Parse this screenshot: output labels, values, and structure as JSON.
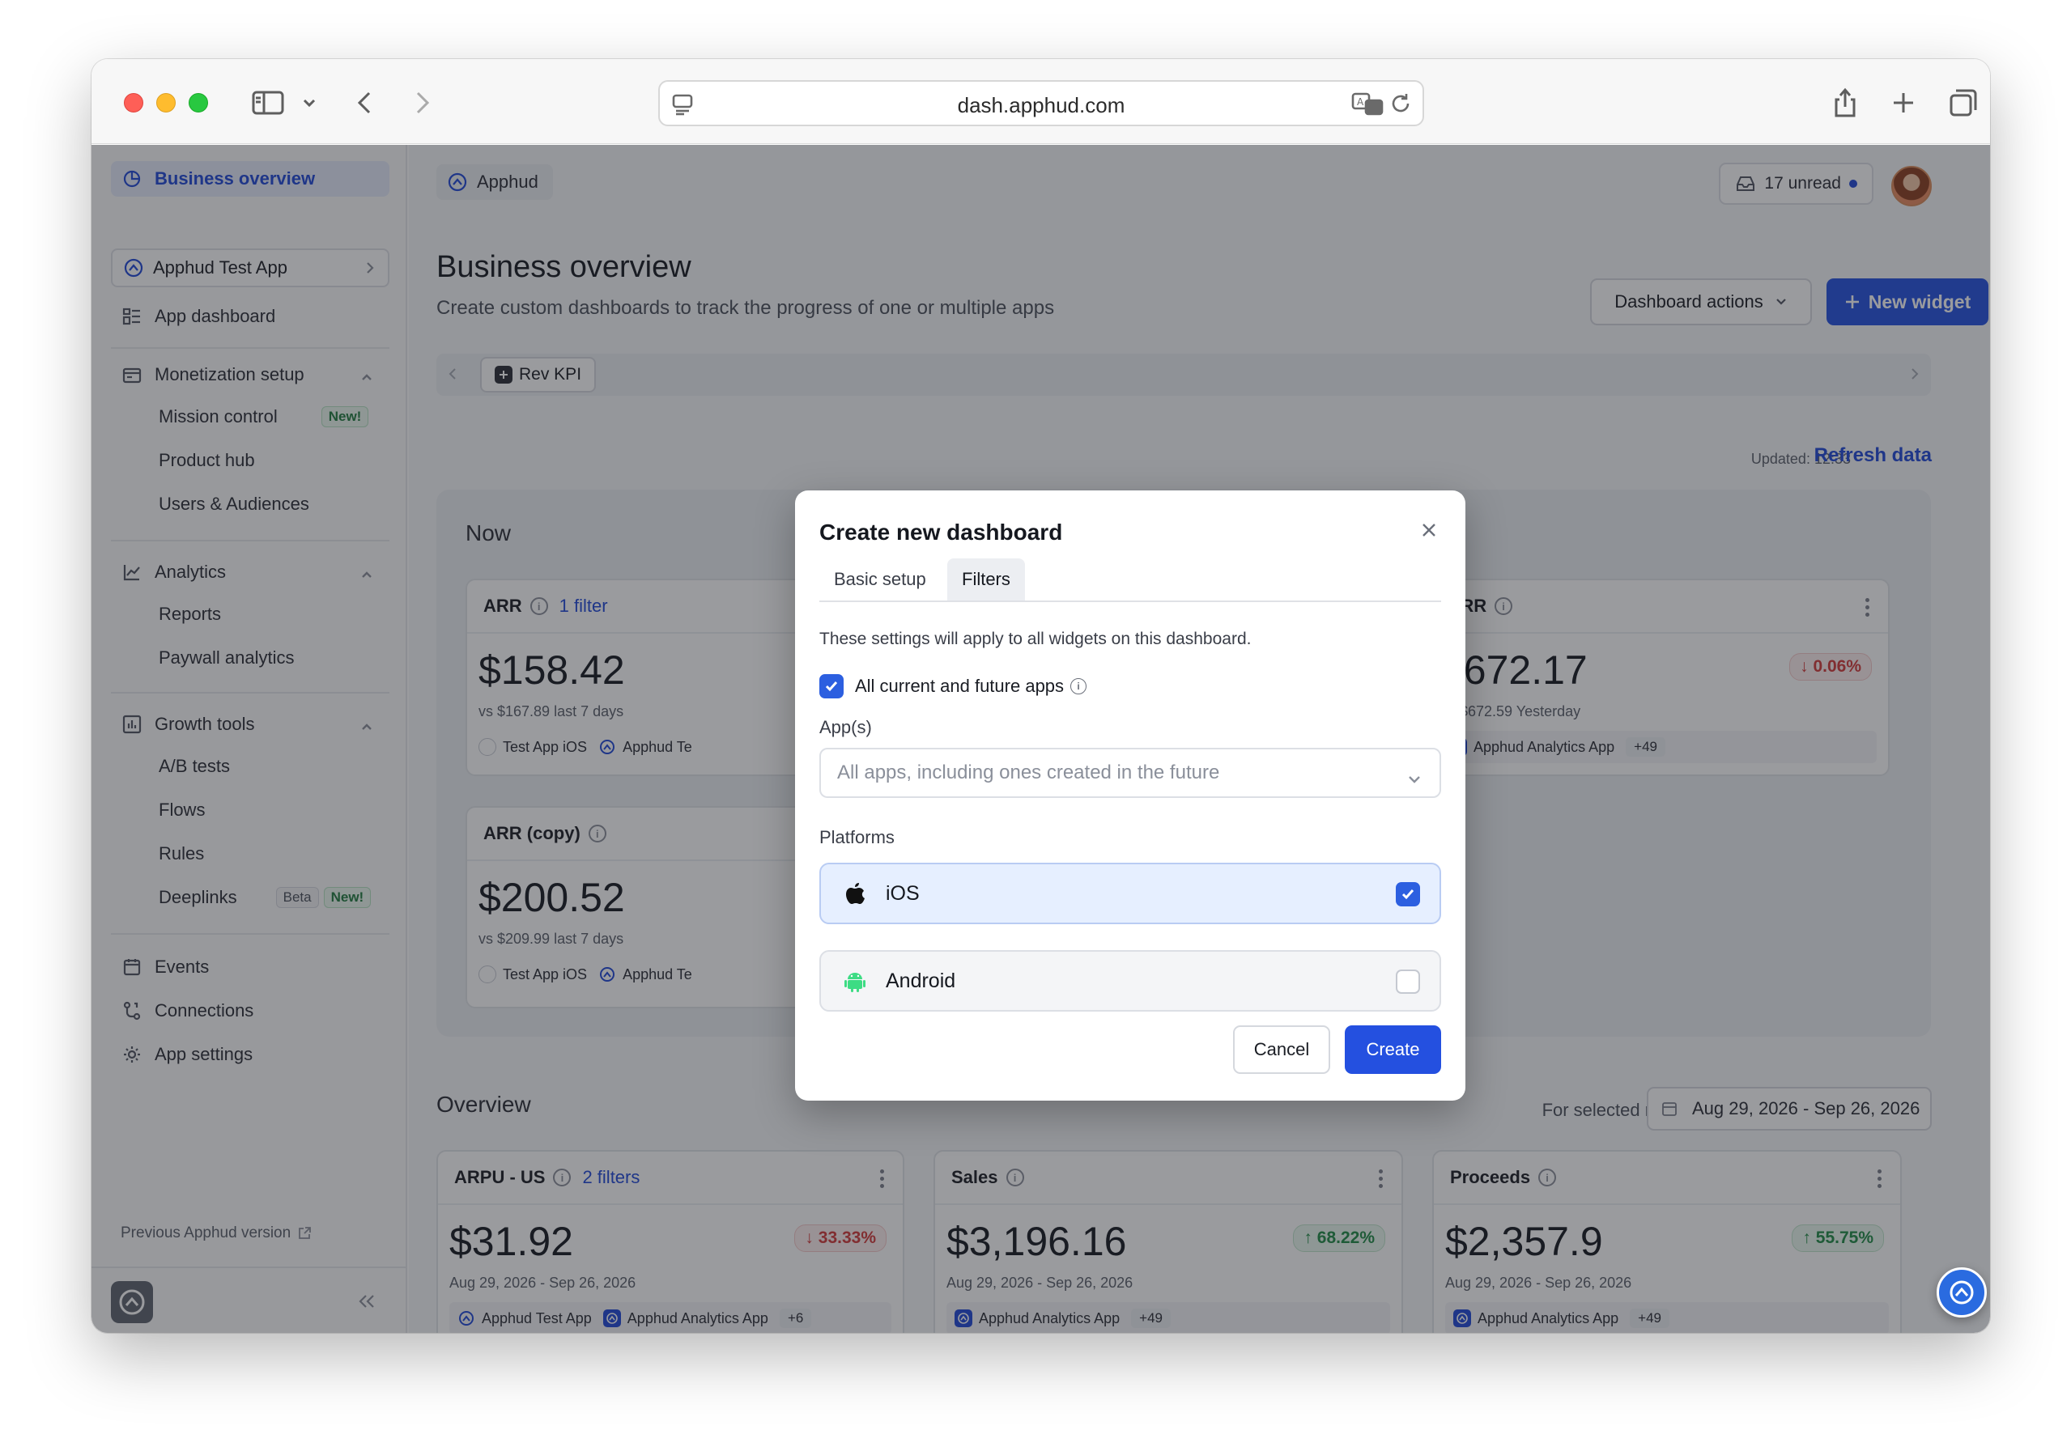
{
  "browser": {
    "url": "dash.apphud.com"
  },
  "sidebar": {
    "active_item": "Business overview",
    "app_selector": "Apphud Test App",
    "app_dashboard": "App dashboard",
    "monetization": {
      "label": "Monetization setup",
      "items": [
        "Mission control",
        "Product hub",
        "Users & Audiences"
      ]
    },
    "analytics": {
      "label": "Analytics",
      "items": [
        "Reports",
        "Paywall analytics"
      ]
    },
    "growth": {
      "label": "Growth tools",
      "items": [
        "A/B tests",
        "Flows",
        "Rules",
        "Deeplinks"
      ]
    },
    "events": "Events",
    "connections": "Connections",
    "app_settings": "App settings",
    "previous_version": "Previous Apphud version",
    "badge_new": "New!",
    "badge_beta": "Beta",
    "collapse_icon": "double-chevron-left-icon"
  },
  "header": {
    "breadcrumb": "Apphud",
    "unread": "17 unread",
    "title": "Business overview",
    "subtitle": "Create custom dashboards to track the progress of one or multiple apps",
    "dashboard_actions": "Dashboard actions",
    "new_widget": "New widget",
    "tab": "Rev KPI",
    "updated": "Updated: 12:33",
    "refresh": "Refresh data"
  },
  "now": {
    "title": "Now",
    "arr": {
      "label": "ARR",
      "filter": "1 filter",
      "value": "$158.42",
      "compare": "vs $167.89 last 7 days",
      "app1": "Test App iOS",
      "app2": "Apphud Te"
    },
    "arr_copy": {
      "label": "ARR (copy)",
      "value": "$200.52",
      "compare": "vs $209.99 last 7 days",
      "app1": "Test App iOS",
      "app2": "Apphud Te"
    },
    "mrr": {
      "label": "MRR",
      "value": "$672.17",
      "delta": "0.06%",
      "compare": "vs $672.59 Yesterday",
      "app1": "Apphud Analytics App",
      "more": "+49"
    }
  },
  "overview": {
    "title": "Overview",
    "range_label": "For selected range",
    "range": "Aug 29, 2026 - Sep 26, 2026",
    "arpu": {
      "label": "ARPU - US",
      "filter": "2 filters",
      "value": "$31.92",
      "delta": "33.33%",
      "range": "Aug 29, 2026 - Sep 26, 2026",
      "app1": "Apphud Test App",
      "app2": "Apphud Analytics App",
      "more": "+6"
    },
    "sales": {
      "label": "Sales",
      "value": "$3,196.16",
      "delta": "68.22%",
      "range": "Aug 29, 2026 - Sep 26, 2026",
      "app1": "Apphud Analytics App",
      "more": "+49"
    },
    "proceeds": {
      "label": "Proceeds",
      "value": "$2,357.9",
      "delta": "55.75%",
      "range": "Aug 29, 2026 - Sep 26, 2026",
      "app1": "Apphud Analytics App",
      "more": "+49"
    }
  },
  "modal": {
    "title": "Create new dashboard",
    "tabs": [
      "Basic setup",
      "Filters"
    ],
    "active_tab": "Filters",
    "description": "These settings will apply to all widgets on this dashboard.",
    "all_apps_label": "All current and future apps",
    "all_apps_checked": true,
    "apps_label": "App(s)",
    "apps_placeholder": "All apps, including ones created in the future",
    "platforms_label": "Platforms",
    "platforms": [
      {
        "name": "iOS",
        "checked": true,
        "icon": "apple-icon"
      },
      {
        "name": "Android",
        "checked": false,
        "icon": "android-icon"
      }
    ],
    "cancel": "Cancel",
    "create": "Create"
  },
  "colors": {
    "primary": "#2450e0",
    "accent_link": "#1f48d8",
    "selected_bg": "#e6efff",
    "up": "#1f8a45",
    "down": "#d23a3a"
  }
}
